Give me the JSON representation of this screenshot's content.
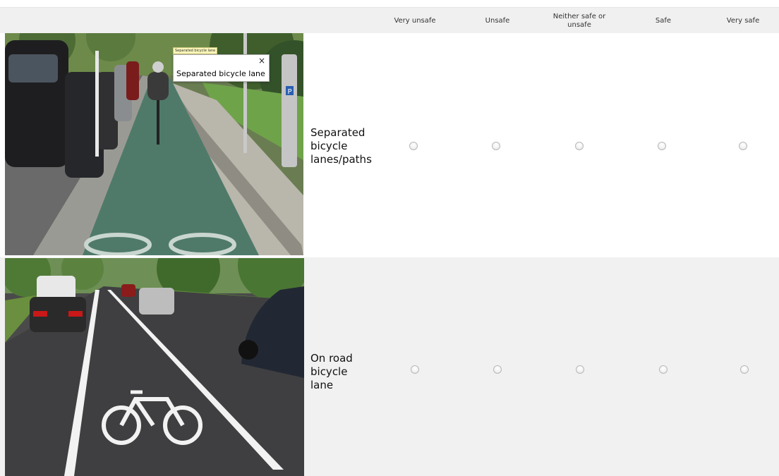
{
  "columns": [
    "Very unsafe",
    "Unsafe",
    "Neither safe or unsafe",
    "Safe",
    "Very safe"
  ],
  "rows": [
    {
      "label": "Separated bicycle lanes/paths",
      "image_tooltip": "Separated bicycle lane",
      "popup_title": "Separated bicycle lane",
      "popup_close": "×",
      "selected": null
    },
    {
      "label": "On road bicycle lane",
      "selected": null
    }
  ],
  "colors": {
    "header_bg": "#f0f0f0",
    "row_alt_bg": "#f1f1f1",
    "bike_lane_green": "#4f7a6a",
    "road_asphalt": "#4a4a4a",
    "parking_sign_blue": "#2a5fb0"
  }
}
